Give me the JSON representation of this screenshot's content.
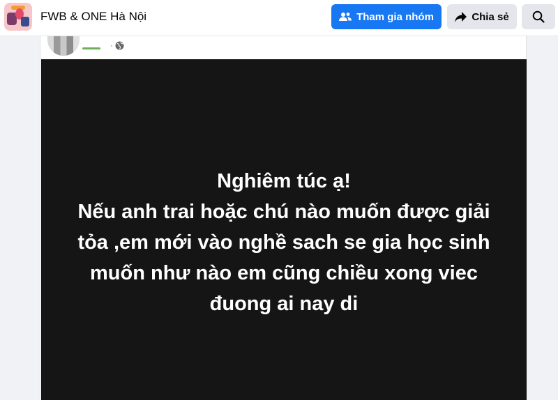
{
  "header": {
    "group_name": "FWB & ONE Hà Nội",
    "join_label": "Tham gia nhóm",
    "share_label": "Chia sẻ"
  },
  "post": {
    "meta_dot": "·",
    "image_lines": [
      "Nghiêm túc ạ!",
      "Nếu anh trai hoặc chú nào muốn được giải",
      "tỏa ,em mới vào nghề sach se gia học sinh",
      "muốn như nào em cũng chiều xong viec",
      "đuong ai nay di"
    ]
  },
  "colors": {
    "accent": "#1877f2",
    "image_bg": "#151515",
    "button_bg": "#e4e6eb"
  },
  "icons": [
    "group-avatar",
    "people-icon",
    "share-arrow-icon",
    "search-icon",
    "globe-icon"
  ]
}
